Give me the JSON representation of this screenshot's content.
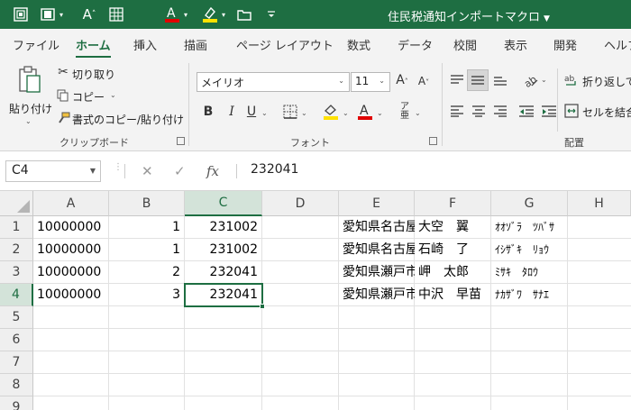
{
  "title_bar": {
    "doc_title": "住民税通知インポートマクロ",
    "quick_access": [
      {
        "name": "sheet-view-icon",
        "glyph": "▦"
      },
      {
        "name": "filmstrip-icon",
        "glyph": "▤"
      },
      {
        "name": "font-size-increase-icon",
        "glyph": "A˄"
      },
      {
        "name": "table-icon",
        "glyph": "⊞"
      },
      {
        "name": "font-color-icon",
        "glyph": "A"
      },
      {
        "name": "highlight-icon",
        "glyph": "✎"
      },
      {
        "name": "folder-icon",
        "glyph": "▭"
      },
      {
        "name": "customize-qat-icon",
        "glyph": "▿"
      }
    ]
  },
  "tabs": [
    "ファイル",
    "ホーム",
    "挿入",
    "描画",
    "ページ レイアウト",
    "数式",
    "データ",
    "校閲",
    "表示",
    "開発",
    "ヘルプ"
  ],
  "active_tab": "ホーム",
  "clipboard": {
    "paste": "貼り付け",
    "cut": "切り取り",
    "copy": "コピー",
    "format_painter": "書式のコピー/貼り付け",
    "group_label": "クリップボード"
  },
  "font": {
    "font_name": "メイリオ",
    "font_size": "11",
    "bold": "B",
    "italic": "I",
    "underline": "U",
    "group_label": "フォント",
    "font_color": "#e00000",
    "fill_color": "#ffe100"
  },
  "alignment": {
    "wrap_text": "折り返して",
    "merge_center": "セルを結合",
    "group_label": "配置"
  },
  "formula_bar": {
    "name_box": "C4",
    "value": "232041"
  },
  "grid": {
    "columns": [
      "A",
      "B",
      "C",
      "D",
      "E",
      "F",
      "G",
      "H"
    ],
    "rows": [
      "1",
      "2",
      "3",
      "4",
      "5",
      "6",
      "7",
      "8",
      "9"
    ],
    "data": [
      [
        "10000000",
        "1",
        "231002",
        "",
        "愛知県名古屋",
        "大空　翼",
        "ｵｵｿﾞﾗ　ﾂﾊﾞｻ",
        ""
      ],
      [
        "10000000",
        "1",
        "231002",
        "",
        "愛知県名古屋",
        "石崎　了",
        "ｲｼｻﾞｷ　ﾘｮｳ",
        ""
      ],
      [
        "10000000",
        "2",
        "232041",
        "",
        "愛知県瀬戸市",
        "岬　太郎",
        "ﾐｻｷ　ﾀﾛｳ",
        ""
      ],
      [
        "10000000",
        "3",
        "232041",
        "",
        "愛知県瀬戸市",
        "中沢　早苗",
        "ﾅｶｻﾞﾜ　ｻﾅｴ",
        ""
      ]
    ],
    "selected_cell": "C4",
    "accent_color": "#1e6e42"
  }
}
